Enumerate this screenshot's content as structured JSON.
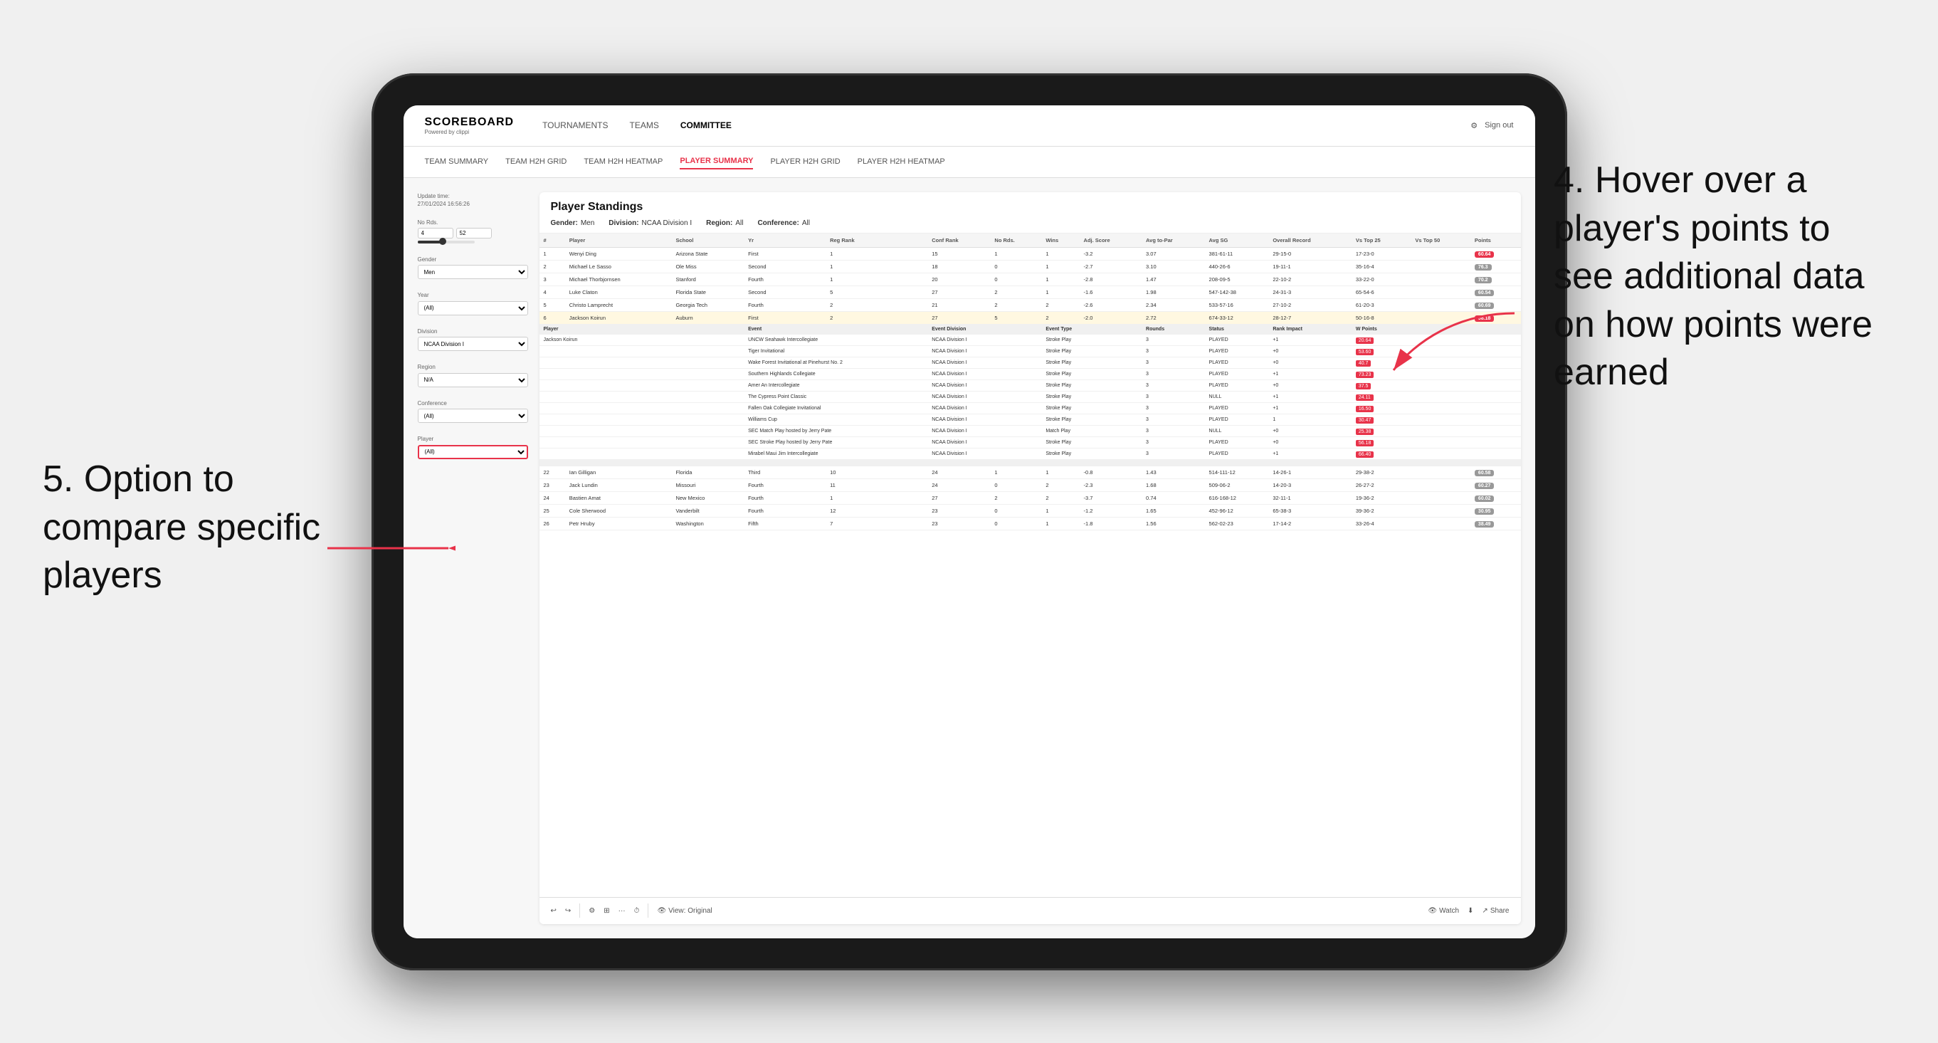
{
  "page": {
    "background": "#f0f0f0"
  },
  "annotations": {
    "right": {
      "text": "4. Hover over a player's points to see additional data on how points were earned"
    },
    "left": {
      "text": "5. Option to compare specific players"
    }
  },
  "nav": {
    "logo": "SCOREBOARD",
    "logo_sub": "Powered by clippi",
    "links": [
      "TOURNAMENTS",
      "TEAMS",
      "COMMITTEE"
    ],
    "sign_out": "Sign out"
  },
  "sub_nav": {
    "links": [
      "TEAM SUMMARY",
      "TEAM H2H GRID",
      "TEAM H2H HEATMAP",
      "PLAYER SUMMARY",
      "PLAYER H2H GRID",
      "PLAYER H2H HEATMAP"
    ],
    "active": "PLAYER SUMMARY"
  },
  "sidebar": {
    "update_time_label": "Update time:",
    "update_time_value": "27/01/2024 16:56:26",
    "no_rds_label": "No Rds.",
    "no_rds_min": "4",
    "no_rds_max": "52",
    "gender_label": "Gender",
    "gender_value": "Men",
    "year_label": "Year",
    "year_value": "(All)",
    "division_label": "Division",
    "division_value": "NCAA Division I",
    "region_label": "Region",
    "region_value": "N/A",
    "conference_label": "Conference",
    "conference_value": "(All)",
    "player_label": "Player",
    "player_value": "(All)"
  },
  "main_table": {
    "title": "Player Standings",
    "gender_label": "Gender:",
    "gender_value": "Men",
    "division_label": "Division:",
    "division_value": "NCAA Division I",
    "region_label": "Region:",
    "region_value": "All",
    "conference_label": "Conference:",
    "conference_value": "All",
    "headers": [
      "#",
      "Player",
      "School",
      "Yr",
      "Reg Rank",
      "Conf Rank",
      "No Rds.",
      "Wins",
      "Adj. Score",
      "Avg to-Par",
      "Avg SG",
      "Overall Record",
      "Vs Top 25",
      "Vs Top 50",
      "Points"
    ],
    "rows": [
      {
        "num": "1",
        "player": "Wenyi Ding",
        "school": "Arizona State",
        "yr": "First",
        "reg_rank": "1",
        "conf_rank": "15",
        "no_rds": "1",
        "wins": "1",
        "adj_score": "-3.2",
        "avg_to_par": "3.07",
        "avg_sg": "381-61-11",
        "overall": "29-15-0",
        "top25": "17-23-0",
        "top50": "",
        "points": "60.64",
        "points_highlight": true
      },
      {
        "num": "2",
        "player": "Michael Le Sasso",
        "school": "Ole Miss",
        "yr": "Second",
        "reg_rank": "1",
        "conf_rank": "18",
        "no_rds": "0",
        "wins": "1",
        "adj_score": "-2.7",
        "avg_to_par": "3.10",
        "avg_sg": "440-26-6",
        "overall": "19-11-1",
        "top25": "35-16-4",
        "top50": "",
        "points": "76.3"
      },
      {
        "num": "3",
        "player": "Michael Thorbjornsen",
        "school": "Stanford",
        "yr": "Fourth",
        "reg_rank": "1",
        "conf_rank": "20",
        "no_rds": "0",
        "wins": "1",
        "adj_score": "-2.8",
        "avg_to_par": "1.47",
        "avg_sg": "208-09-5",
        "overall": "22-10-2",
        "top25": "33-22-0",
        "top50": "",
        "points": "70.2"
      },
      {
        "num": "4",
        "player": "Luke Claton",
        "school": "Florida State",
        "yr": "Second",
        "reg_rank": "5",
        "conf_rank": "27",
        "no_rds": "2",
        "wins": "1",
        "adj_score": "-1.6",
        "avg_to_par": "1.98",
        "avg_sg": "547-142-38",
        "overall": "24-31-3",
        "top25": "65-54-6",
        "top50": "",
        "points": "60.54"
      },
      {
        "num": "5",
        "player": "Christo Lamprecht",
        "school": "Georgia Tech",
        "yr": "Fourth",
        "reg_rank": "2",
        "conf_rank": "21",
        "no_rds": "2",
        "wins": "2",
        "adj_score": "-2.6",
        "avg_to_par": "2.34",
        "avg_sg": "533-57-16",
        "overall": "27-10-2",
        "top25": "61-20-3",
        "top50": "",
        "points": "60.69"
      },
      {
        "num": "6",
        "player": "Jackson Koirun",
        "school": "Auburn",
        "yr": "First",
        "reg_rank": "2",
        "conf_rank": "27",
        "no_rds": "5",
        "wins": "2",
        "adj_score": "-2.0",
        "avg_to_par": "2.72",
        "avg_sg": "674-33-12",
        "overall": "28-12-7",
        "top25": "50-16-8",
        "top50": "",
        "points": "58.18"
      }
    ],
    "tooltip_player": "Jackson Koirun",
    "tooltip_rows": [
      {
        "player": "Jackson Koirun",
        "event": "UNCW Seahawk Intercollegiate",
        "division": "NCAA Division I",
        "type": "Stroke Play",
        "rounds": "3",
        "status": "PLAYED",
        "rank_impact": "+1",
        "w_points": "20.64"
      },
      {
        "player": "",
        "event": "Tiger Invitational",
        "division": "NCAA Division I",
        "type": "Stroke Play",
        "rounds": "3",
        "status": "PLAYED",
        "rank_impact": "+0",
        "w_points": "53.60"
      },
      {
        "player": "",
        "event": "Wake Forest Invitational at Pinehurst No. 2",
        "division": "NCAA Division I",
        "type": "Stroke Play",
        "rounds": "3",
        "status": "PLAYED",
        "rank_impact": "+0",
        "w_points": "40.7"
      },
      {
        "player": "",
        "event": "Southern Highlands Collegiate",
        "division": "NCAA Division I",
        "type": "Stroke Play",
        "rounds": "3",
        "status": "PLAYED",
        "rank_impact": "+1",
        "w_points": "73.23"
      },
      {
        "player": "",
        "event": "Amer An Intercollegiate",
        "division": "NCAA Division I",
        "type": "Stroke Play",
        "rounds": "3",
        "status": "PLAYED",
        "rank_impact": "+0",
        "w_points": "37.5"
      },
      {
        "player": "",
        "event": "The Cypress Point Classic",
        "division": "NCAA Division I",
        "type": "Stroke Play",
        "rounds": "3",
        "status": "NULL",
        "rank_impact": "+1",
        "w_points": "24.11"
      },
      {
        "player": "",
        "event": "Fallen Oak Collegiate Invitational",
        "division": "NCAA Division I",
        "type": "Stroke Play",
        "rounds": "3",
        "status": "PLAYED",
        "rank_impact": "+1",
        "w_points": "16.50"
      },
      {
        "player": "",
        "event": "Williams Cup",
        "division": "NCAA Division I",
        "type": "Stroke Play",
        "rounds": "3",
        "status": "PLAYED",
        "rank_impact": "1",
        "w_points": "30.47"
      },
      {
        "player": "",
        "event": "SEC Match Play hosted by Jerry Pate",
        "division": "NCAA Division I",
        "type": "Match Play",
        "rounds": "3",
        "status": "NULL",
        "rank_impact": "+0",
        "w_points": "25.38"
      },
      {
        "player": "",
        "event": "SEC Stroke Play hosted by Jerry Pate",
        "division": "NCAA Division I",
        "type": "Stroke Play",
        "rounds": "3",
        "status": "PLAYED",
        "rank_impact": "+0",
        "w_points": "56.18"
      },
      {
        "player": "",
        "event": "Mirabel Maui Jim Intercollegiate",
        "division": "NCAA Division I",
        "type": "Stroke Play",
        "rounds": "3",
        "status": "PLAYED",
        "rank_impact": "+1",
        "w_points": "66.40"
      }
    ],
    "lower_rows": [
      {
        "num": "22",
        "player": "Ian Gilligan",
        "school": "Florida",
        "yr": "Third",
        "reg_rank": "10",
        "conf_rank": "24",
        "no_rds": "1",
        "wins": "1",
        "adj_score": "-0.8",
        "avg_to_par": "1.43",
        "avg_sg": "514-111-12",
        "overall": "14-26-1",
        "top25": "29-38-2",
        "top50": "",
        "points": "60.58"
      },
      {
        "num": "23",
        "player": "Jack Lundin",
        "school": "Missouri",
        "yr": "Fourth",
        "reg_rank": "11",
        "conf_rank": "24",
        "no_rds": "0",
        "wins": "2",
        "adj_score": "-2.3",
        "avg_to_par": "1.68",
        "avg_sg": "509-06-2",
        "overall": "14-20-3",
        "top25": "26-27-2",
        "top50": "",
        "points": "60.27"
      },
      {
        "num": "24",
        "player": "Bastien Amat",
        "school": "New Mexico",
        "yr": "Fourth",
        "reg_rank": "1",
        "conf_rank": "27",
        "no_rds": "2",
        "wins": "2",
        "adj_score": "-3.7",
        "avg_to_par": "0.74",
        "avg_sg": "616-168-12",
        "overall": "32-11-1",
        "top25": "19-36-2",
        "top50": "",
        "points": "60.02"
      },
      {
        "num": "25",
        "player": "Cole Sherwood",
        "school": "Vanderbilt",
        "yr": "Fourth",
        "reg_rank": "12",
        "conf_rank": "23",
        "no_rds": "0",
        "wins": "1",
        "adj_score": "-1.2",
        "avg_to_par": "1.65",
        "avg_sg": "452-96-12",
        "overall": "65-38-3",
        "top25": "39-36-2",
        "top50": "",
        "points": "30.95"
      },
      {
        "num": "26",
        "player": "Petr Hruby",
        "school": "Washington",
        "yr": "Fifth",
        "reg_rank": "7",
        "conf_rank": "23",
        "no_rds": "0",
        "wins": "1",
        "adj_score": "-1.8",
        "avg_to_par": "1.56",
        "avg_sg": "562-02-23",
        "overall": "17-14-2",
        "top25": "33-26-4",
        "top50": "",
        "points": "38.49"
      }
    ]
  },
  "toolbar": {
    "undo": "↩",
    "redo": "↪",
    "view_label": "View: Original",
    "watch": "Watch",
    "download": "⬇",
    "share": "Share"
  }
}
